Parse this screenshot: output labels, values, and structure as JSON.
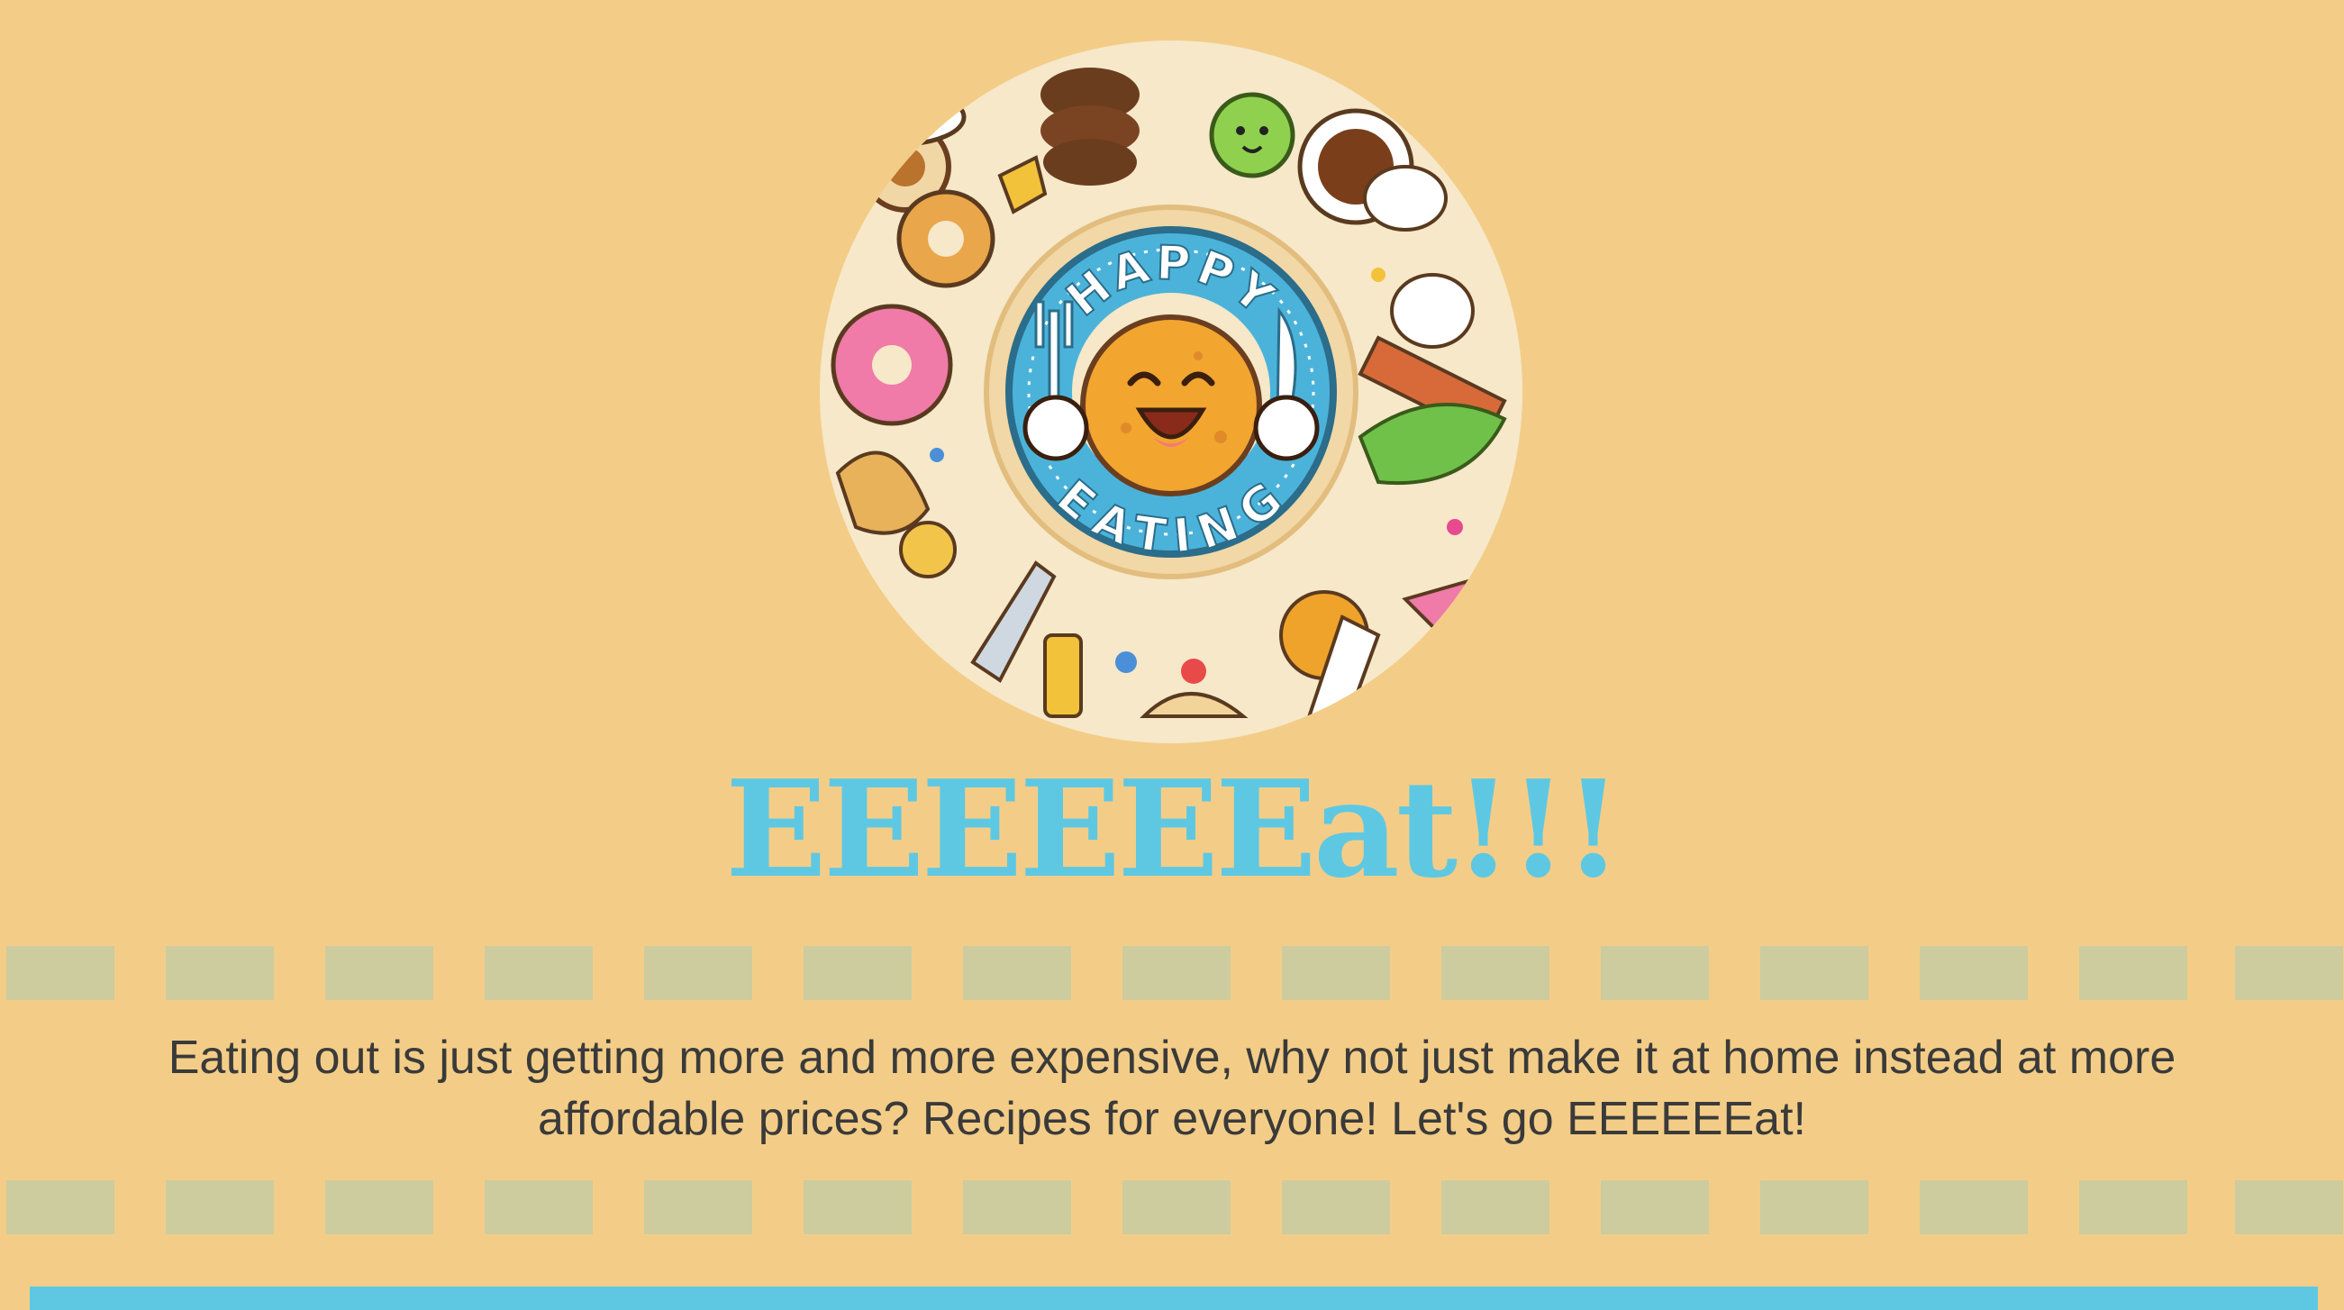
{
  "logo": {
    "arc_top": "HAPPY",
    "arc_bottom": "EATING"
  },
  "title": "EEEEEEat!!!",
  "description": "Eating out is just getting more and more expensive, why not just make it at home instead at more affordable prices? Recipes for everyone! Let's go EEEEEEat!",
  "colors": {
    "background": "#f3cd87",
    "accent": "#5ec8e3",
    "divider": "#cccc9f",
    "text": "#3a3a3a"
  }
}
